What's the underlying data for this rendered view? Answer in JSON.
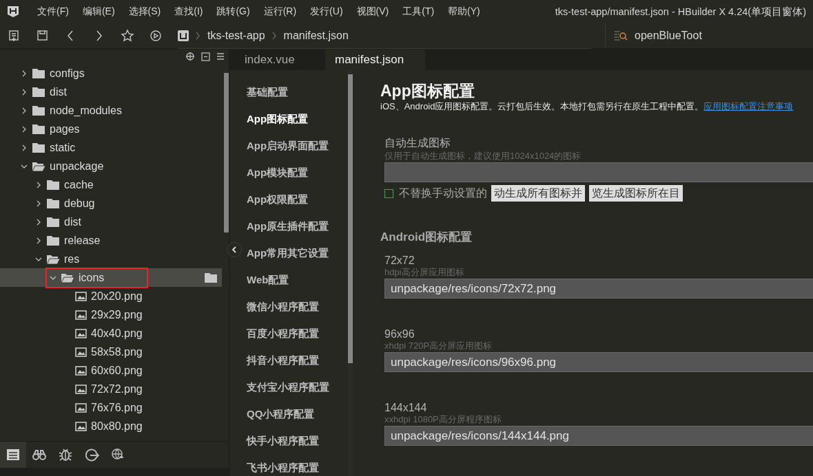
{
  "menu_bar": {
    "items": [
      "文件(F)",
      "编辑(E)",
      "选择(S)",
      "查找(I)",
      "跳转(G)",
      "运行(R)",
      "发行(U)",
      "视图(V)",
      "工具(T)",
      "帮助(Y)"
    ],
    "window_title": "tks-test-app/manifest.json - HBuilder X 4.24(单项目窗体)"
  },
  "toolbar": {
    "breadcrumb": [
      "tks-test-app",
      "manifest.json"
    ],
    "search": {
      "value": "openBlueToot"
    }
  },
  "project_tree": [
    {
      "kind": "folder",
      "label": "configs",
      "expanded": false,
      "selected": false
    },
    {
      "kind": "folder",
      "label": "dist",
      "expanded": false,
      "selected": false
    },
    {
      "kind": "folder",
      "label": "node_modules",
      "expanded": false,
      "selected": false
    },
    {
      "kind": "folder",
      "label": "pages",
      "expanded": false,
      "selected": false
    },
    {
      "kind": "folder",
      "label": "static",
      "expanded": false,
      "selected": false
    },
    {
      "kind": "folder",
      "label": "unpackage",
      "expanded": true,
      "selected": false,
      "children": [
        {
          "kind": "folder",
          "label": "cache",
          "expanded": false,
          "selected": false
        },
        {
          "kind": "folder",
          "label": "debug",
          "expanded": false,
          "selected": false
        },
        {
          "kind": "folder",
          "label": "dist",
          "expanded": false,
          "selected": false
        },
        {
          "kind": "folder",
          "label": "release",
          "expanded": false,
          "selected": false
        },
        {
          "kind": "folder",
          "label": "res",
          "expanded": true,
          "selected": false,
          "children": [
            {
              "kind": "folder",
              "label": "icons",
              "expanded": true,
              "selected": true,
              "annotated": true,
              "children": [
                {
                  "kind": "file",
                  "label": "20x20.png",
                  "selected": false
                },
                {
                  "kind": "file",
                  "label": "29x29.png",
                  "selected": false
                },
                {
                  "kind": "file",
                  "label": "40x40.png",
                  "selected": false
                },
                {
                  "kind": "file",
                  "label": "58x58.png",
                  "selected": false
                },
                {
                  "kind": "file",
                  "label": "60x60.png",
                  "selected": false
                },
                {
                  "kind": "file",
                  "label": "72x72.png",
                  "selected": false
                },
                {
                  "kind": "file",
                  "label": "76x76.png",
                  "selected": false
                },
                {
                  "kind": "file",
                  "label": "80x80.png",
                  "selected": false
                }
              ]
            }
          ]
        }
      ]
    }
  ],
  "side_tabs": [
    {
      "selected": true
    },
    {
      "selected": false
    },
    {
      "selected": false
    },
    {
      "selected": false
    },
    {
      "selected": false
    }
  ],
  "editor_tabs": [
    {
      "label": "index.vue",
      "selected": false
    },
    {
      "label": "manifest.json",
      "selected": true
    }
  ],
  "settings_nav": [
    {
      "label": "基础配置",
      "selected": false
    },
    {
      "label": "App图标配置",
      "selected": true
    },
    {
      "label": "App启动界面配置",
      "selected": false
    },
    {
      "label": "App模块配置",
      "selected": false
    },
    {
      "label": "App权限配置",
      "selected": false
    },
    {
      "label": "App原生插件配置",
      "selected": false
    },
    {
      "label": "App常用其它设置",
      "selected": false
    },
    {
      "label": "Web配置",
      "selected": false
    },
    {
      "label": "微信小程序配置",
      "selected": false
    },
    {
      "label": "百度小程序配置",
      "selected": false
    },
    {
      "label": "抖音小程序配置",
      "selected": false
    },
    {
      "label": "支付宝小程序配置",
      "selected": false
    },
    {
      "label": "QQ小程序配置",
      "selected": false
    },
    {
      "label": "快手小程序配置",
      "selected": false
    },
    {
      "label": "飞书小程序配置",
      "selected": false
    }
  ],
  "content": {
    "title": "App图标配置",
    "description": "iOS、Android应用图标配置。云打包后生效。本地打包需另行在原生工程中配置。",
    "description_link": "应用图标配置注意事项",
    "auto_generate": {
      "label": "自动生成图标",
      "hint": "仅用于自动生成图标，建议使用1024x1024的图标",
      "checkbox": {
        "label": "不替换手动设置的",
        "checked": false
      },
      "buttons": [
        "动生成所有图标并",
        "览生成图标所在目"
      ]
    },
    "android_heading": "Android图标配置",
    "android_fields": [
      {
        "label": "72x72",
        "hint": "hdpi高分屏应用图标",
        "value": "unpackage/res/icons/72x72.png"
      },
      {
        "label": "96x96",
        "hint": "xhdpi 720P高分屏应用图标",
        "value": "unpackage/res/icons/96x96.png"
      },
      {
        "label": "144x144",
        "hint": "xxhdpi 1080P高分屏程序图标",
        "value": "unpackage/res/icons/144x144.png"
      }
    ]
  }
}
